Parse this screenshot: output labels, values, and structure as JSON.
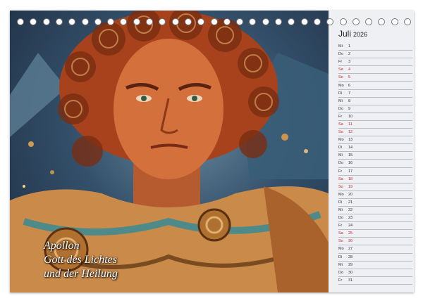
{
  "calendar": {
    "month": "Juli",
    "year": "2026",
    "days": [
      {
        "wd": "Mi",
        "d": "1",
        "weekend": false
      },
      {
        "wd": "Do",
        "d": "2",
        "weekend": false
      },
      {
        "wd": "Fr",
        "d": "3",
        "weekend": false
      },
      {
        "wd": "Sa",
        "d": "4",
        "weekend": true
      },
      {
        "wd": "So",
        "d": "5",
        "weekend": true
      },
      {
        "wd": "Mo",
        "d": "6",
        "weekend": false
      },
      {
        "wd": "Di",
        "d": "7",
        "weekend": false
      },
      {
        "wd": "Mi",
        "d": "8",
        "weekend": false
      },
      {
        "wd": "Do",
        "d": "9",
        "weekend": false
      },
      {
        "wd": "Fr",
        "d": "10",
        "weekend": false
      },
      {
        "wd": "Sa",
        "d": "11",
        "weekend": true
      },
      {
        "wd": "So",
        "d": "12",
        "weekend": true
      },
      {
        "wd": "Mo",
        "d": "13",
        "weekend": false
      },
      {
        "wd": "Di",
        "d": "14",
        "weekend": false
      },
      {
        "wd": "Mi",
        "d": "15",
        "weekend": false
      },
      {
        "wd": "Do",
        "d": "16",
        "weekend": false
      },
      {
        "wd": "Fr",
        "d": "17",
        "weekend": false
      },
      {
        "wd": "Sa",
        "d": "18",
        "weekend": true
      },
      {
        "wd": "So",
        "d": "19",
        "weekend": true
      },
      {
        "wd": "Mo",
        "d": "20",
        "weekend": false
      },
      {
        "wd": "Di",
        "d": "21",
        "weekend": false
      },
      {
        "wd": "Mi",
        "d": "22",
        "weekend": false
      },
      {
        "wd": "Do",
        "d": "23",
        "weekend": false
      },
      {
        "wd": "Fr",
        "d": "24",
        "weekend": false
      },
      {
        "wd": "Sa",
        "d": "25",
        "weekend": true
      },
      {
        "wd": "So",
        "d": "26",
        "weekend": true
      },
      {
        "wd": "Mo",
        "d": "27",
        "weekend": false
      },
      {
        "wd": "Di",
        "d": "28",
        "weekend": false
      },
      {
        "wd": "Mi",
        "d": "29",
        "weekend": false
      },
      {
        "wd": "Do",
        "d": "30",
        "weekend": false
      },
      {
        "wd": "Fr",
        "d": "31",
        "weekend": false
      }
    ]
  },
  "caption": {
    "line1": "Apollon",
    "line2": "Gott des Lichtes",
    "line3": "und der Heilung"
  },
  "colors": {
    "weekend": "#c0282d",
    "hair": "#a8421c",
    "skin": "#d4703c",
    "armor": "#c98a4a"
  }
}
